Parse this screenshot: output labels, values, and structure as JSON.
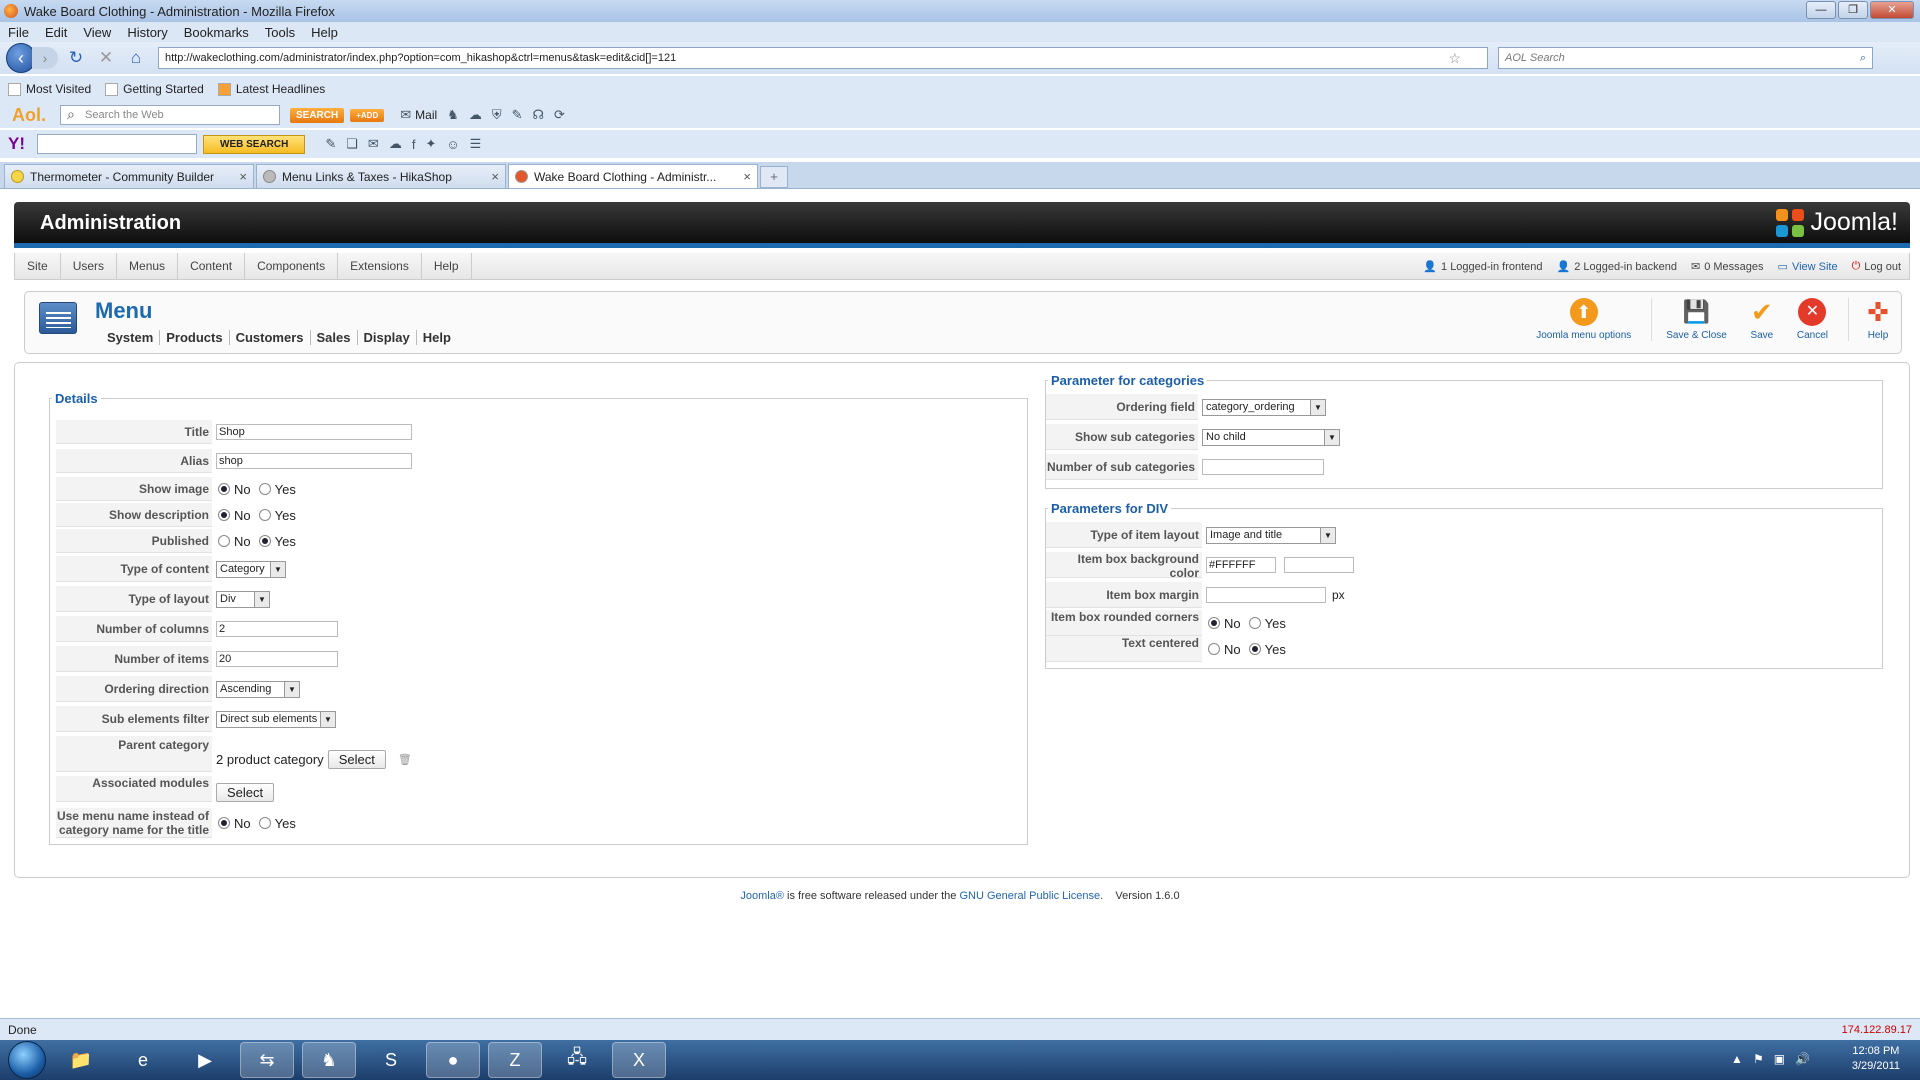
{
  "window": {
    "title": "Wake Board Clothing - Administration - Mozilla Firefox"
  },
  "menubar": [
    "File",
    "Edit",
    "View",
    "History",
    "Bookmarks",
    "Tools",
    "Help"
  ],
  "url": "http://wakeclothing.com/administrator/index.php?option=com_hikashop&ctrl=menus&task=edit&cid[]=121",
  "search_placeholder": "AOL Search",
  "bookmarks": [
    "Most Visited",
    "Getting Started",
    "Latest Headlines"
  ],
  "aol": {
    "logo": "Aol.",
    "search_placeholder": "Search the Web",
    "search_btn": "SEARCH",
    "add_btn": "+ADD",
    "mail": "Mail"
  },
  "yahoo": {
    "logo": "Y!",
    "web_search": "WEB SEARCH"
  },
  "tabs": [
    {
      "title": "Thermometer - Community Builder"
    },
    {
      "title": "Menu Links & Taxes - HikaShop"
    },
    {
      "title": "Wake Board Clothing - Administr..."
    }
  ],
  "admin": {
    "header": "Administration",
    "logo_text": "Joomla!",
    "menu": [
      "Site",
      "Users",
      "Menus",
      "Content",
      "Components",
      "Extensions",
      "Help"
    ],
    "status": {
      "frontend": "1 Logged-in frontend",
      "backend": "2 Logged-in backend",
      "messages": "0 Messages",
      "view_site": "View Site",
      "logout": "Log out"
    }
  },
  "toolbar": {
    "title": "Menu",
    "submenu": [
      "System",
      "Products",
      "Customers",
      "Sales",
      "Display",
      "Help"
    ],
    "buttons": {
      "options": "Joomla menu options",
      "save_close": "Save & Close",
      "save": "Save",
      "cancel": "Cancel",
      "help": "Help"
    }
  },
  "details": {
    "legend": "Details",
    "title_label": "Title",
    "title_value": "Shop",
    "alias_label": "Alias",
    "alias_value": "shop",
    "show_image_label": "Show image",
    "show_description_label": "Show description",
    "published_label": "Published",
    "type_content_label": "Type of content",
    "type_content_value": "Category",
    "type_layout_label": "Type of layout",
    "type_layout_value": "Div",
    "num_columns_label": "Number of columns",
    "num_columns_value": "2",
    "num_items_label": "Number of items",
    "num_items_value": "20",
    "ordering_dir_label": "Ordering direction",
    "ordering_dir_value": "Ascending",
    "sub_filter_label": "Sub elements filter",
    "sub_filter_value": "Direct sub elements",
    "parent_label": "Parent category",
    "parent_value": "2 product category",
    "assoc_label": "Associated modules",
    "use_menu_name_label_1": "Use menu name instead of",
    "use_menu_name_label_2": "category name for the title",
    "select": "Select",
    "no": "No",
    "yes": "Yes"
  },
  "categories": {
    "legend": "Parameter for categories",
    "ordering_label": "Ordering field",
    "ordering_value": "category_ordering",
    "show_sub_label": "Show sub categories",
    "show_sub_value": "No child",
    "num_sub_label": "Number of sub categories",
    "num_sub_value": ""
  },
  "div_params": {
    "legend": "Parameters for DIV",
    "type_item_label": "Type of item layout",
    "type_item_value": "Image and title",
    "bg_label": "Item box background color",
    "bg_value": "#FFFFFF",
    "margin_label": "Item box margin",
    "margin_unit": "px",
    "rounded_label": "Item box rounded corners",
    "centered_label": "Text centered",
    "no": "No",
    "yes": "Yes"
  },
  "footer": {
    "joomla": "Joomla®",
    "text1": " is free software released under the ",
    "license": "GNU General Public License",
    "text2": ".    Version 1.6.0"
  },
  "statusbar": {
    "text": "Done",
    "ip": "174.122.89.17"
  },
  "clock": {
    "time": "12:08 PM",
    "date": "3/29/2011"
  }
}
